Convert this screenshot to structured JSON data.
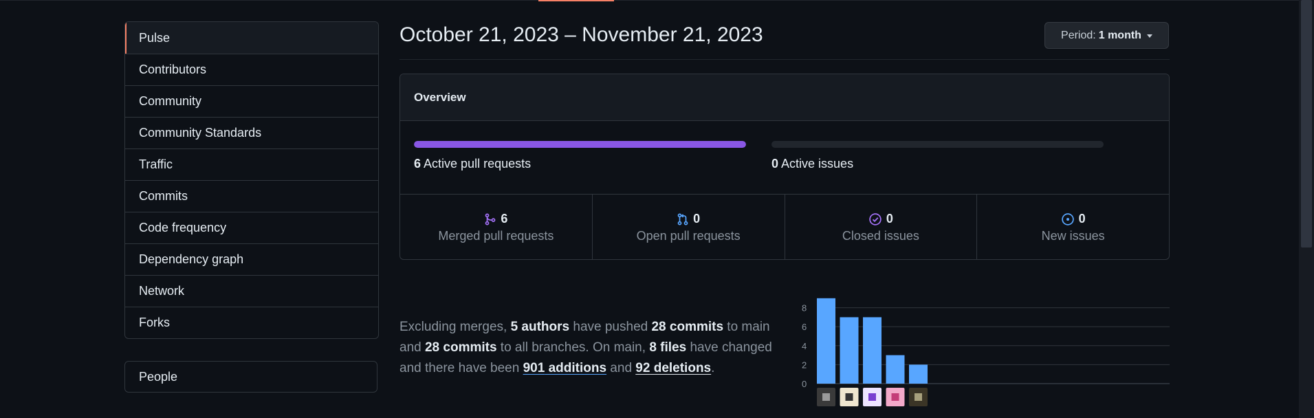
{
  "sidebar": {
    "items": [
      {
        "label": "Pulse",
        "selected": true
      },
      {
        "label": "Contributors"
      },
      {
        "label": "Community"
      },
      {
        "label": "Community Standards"
      },
      {
        "label": "Traffic"
      },
      {
        "label": "Commits"
      },
      {
        "label": "Code frequency"
      },
      {
        "label": "Dependency graph"
      },
      {
        "label": "Network"
      },
      {
        "label": "Forks"
      }
    ],
    "people_label": "People"
  },
  "header": {
    "title": "October 21, 2023 – November 21, 2023",
    "period_label": "Period:",
    "period_value": "1 month"
  },
  "overview": {
    "title": "Overview",
    "pull_requests": {
      "count": "6",
      "label": "Active pull requests",
      "fill_fraction": 1.0,
      "color": "#8957e5"
    },
    "issues": {
      "count": "0",
      "label": "Active issues",
      "fill_fraction": 0
    },
    "stats": [
      {
        "icon": "merged-pr-icon",
        "count": "6",
        "label": "Merged pull requests",
        "color": "#a371f7"
      },
      {
        "icon": "open-pr-icon",
        "count": "0",
        "label": "Open pull requests",
        "color": "#58a6ff"
      },
      {
        "icon": "closed-issue-icon",
        "count": "0",
        "label": "Closed issues",
        "color": "#a371f7"
      },
      {
        "icon": "new-issue-icon",
        "count": "0",
        "label": "New issues",
        "color": "#58a6ff"
      }
    ]
  },
  "commit_summary": {
    "t1": "Excluding merges, ",
    "authors": "5 authors",
    "t2": " have pushed ",
    "commits_main": "28 commits",
    "t3": " to main and ",
    "commits_all": "28 commits",
    "t4": " to all branches. On main, ",
    "files": "8 files",
    "t5": " have changed and there have been ",
    "additions_num": "901",
    "additions_word": " additions",
    "t6": " and ",
    "deletions_num": "92",
    "deletions_word": " deletions",
    "t7": "."
  },
  "chart_data": {
    "type": "bar",
    "categories": [
      "contributor-1",
      "contributor-2",
      "contributor-3",
      "contributor-4",
      "contributor-5"
    ],
    "values": [
      9,
      7,
      7,
      3,
      2
    ],
    "y_ticks": [
      0,
      2,
      4,
      6,
      8
    ],
    "ylim": [
      0,
      9
    ],
    "bar_color": "#58a6ff",
    "grid": true
  }
}
